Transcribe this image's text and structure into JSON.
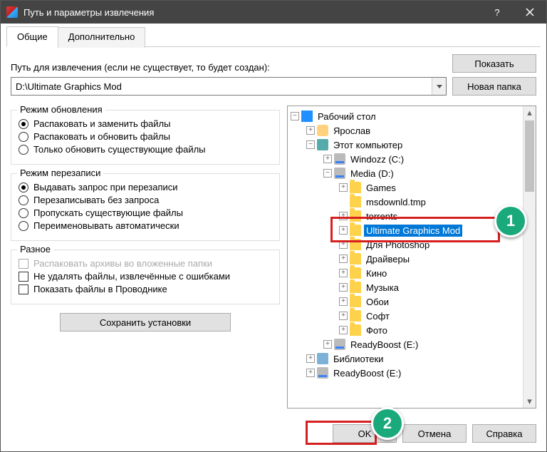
{
  "window": {
    "title": "Путь и параметры извлечения"
  },
  "tabs": {
    "general": "Общие",
    "advanced": "Дополнительно"
  },
  "path": {
    "label": "Путь для извлечения (если не существует, то будет создан):",
    "value": "D:\\Ultimate Graphics Mod"
  },
  "buttons": {
    "show": "Показать",
    "newfolder": "Новая папка",
    "save": "Сохранить установки",
    "ok": "OK",
    "cancel": "Отмена",
    "help": "Справка"
  },
  "groups": {
    "update": {
      "legend": "Режим обновления",
      "r1": "Распаковать и заменить файлы",
      "r2": "Распаковать и обновить файлы",
      "r3": "Только обновить существующие файлы"
    },
    "overwrite": {
      "legend": "Режим перезаписи",
      "r1": "Выдавать запрос при перезаписи",
      "r2": "Перезаписывать без запроса",
      "r3": "Пропускать существующие файлы",
      "r4": "Переименовывать автоматически"
    },
    "misc": {
      "legend": "Разное",
      "c1": "Распаковать архивы во вложенные папки",
      "c2": "Не удалять файлы, извлечённые с ошибками",
      "c3": "Показать файлы в Проводнике"
    }
  },
  "tree": {
    "desktop": "Рабочий стол",
    "user": "Ярослав",
    "thispc": "Этот компьютер",
    "drive_c": "Windozz (C:)",
    "drive_d": "Media (D:)",
    "d_games": "Games",
    "d_msdn": "msdownld.tmp",
    "d_torrents": "torrents",
    "d_ugm": "Ultimate Graphics Mod",
    "d_ps": "Для Photoshop",
    "d_drivers": "Драйверы",
    "d_kino": "Кино",
    "d_music": "Музыка",
    "d_oboi": "Обои",
    "d_soft": "Софт",
    "d_photo": "Фото",
    "drive_e1": "ReadyBoost (E:)",
    "libraries": "Библиотеки",
    "drive_e2": "ReadyBoost (E:)"
  },
  "annotations": {
    "b1": "1",
    "b2": "2"
  }
}
